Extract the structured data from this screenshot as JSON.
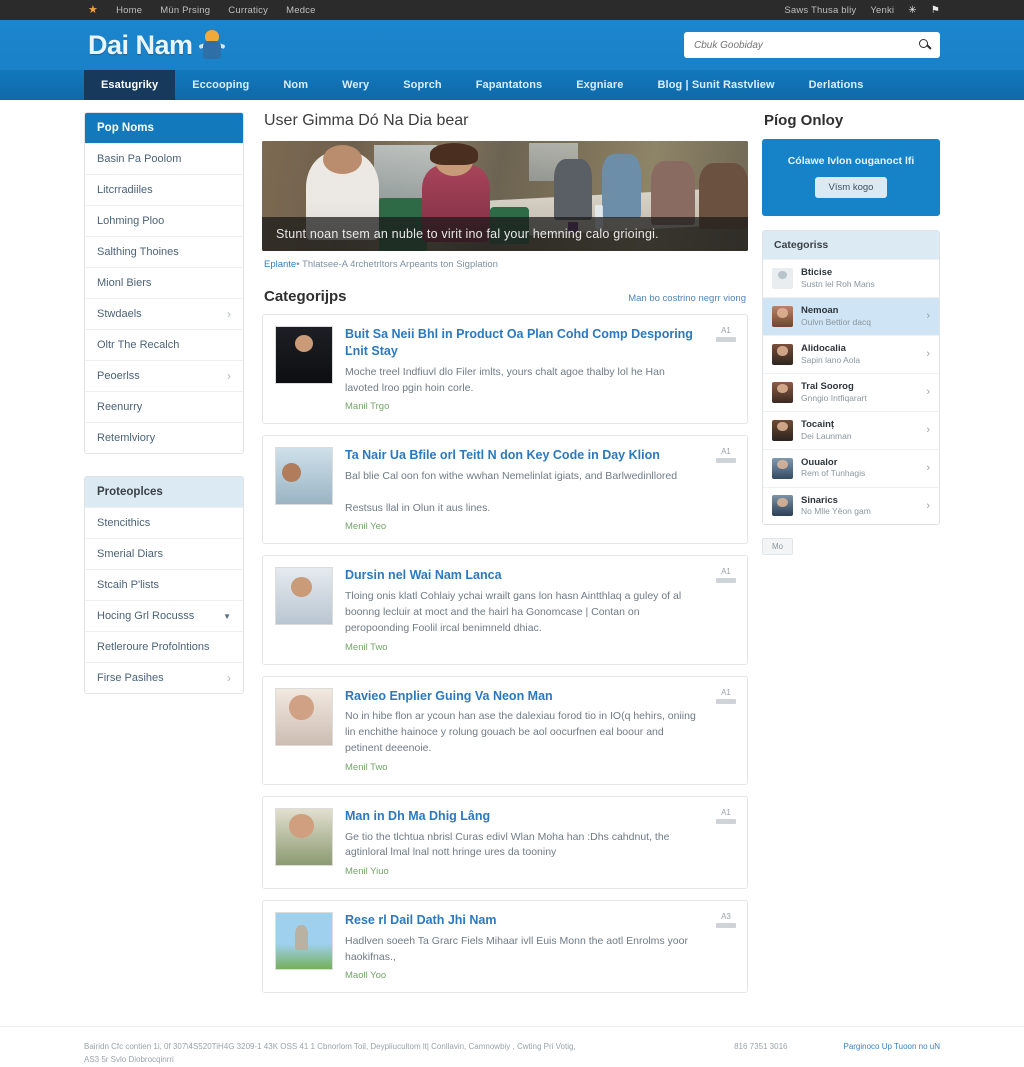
{
  "utilbar": {
    "star_icon": "star-icon",
    "left_items": [
      "Home",
      "Mün Prsing",
      "Curraticy",
      "Medce"
    ],
    "right_items": [
      "Saws Thusa bliy",
      "Yenki"
    ],
    "right_icons": [
      "star-icon",
      "flag-icon"
    ]
  },
  "brand": {
    "name": "Dai Nam",
    "mascot_icon": "mascot-icon"
  },
  "search": {
    "placeholder": "Cbuk Goobiday",
    "value": "",
    "icon": "search-icon"
  },
  "mainnav": {
    "items": [
      {
        "label": "Esatugriky",
        "active": true
      },
      {
        "label": "Eccooping",
        "active": false
      },
      {
        "label": "Nom",
        "active": false
      },
      {
        "label": "Wery",
        "active": false
      },
      {
        "label": "Soprch",
        "active": false
      },
      {
        "label": "Fapantatons",
        "active": false
      },
      {
        "label": "Exgniare",
        "active": false
      },
      {
        "label": "Blog | Sunit Rastvliew",
        "active": false
      },
      {
        "label": "Derlations",
        "active": false
      }
    ]
  },
  "left_sidebar": {
    "panel1": {
      "header": "Pop Noms",
      "items": [
        {
          "label": "Basin Pa Poolom",
          "chevron": false
        },
        {
          "label": "Litcrradiiles",
          "chevron": false
        },
        {
          "label": "Lohming Ploo",
          "chevron": false
        },
        {
          "label": "Salthing Thoines",
          "chevron": false
        },
        {
          "label": "Mionl Biers",
          "chevron": false
        },
        {
          "label": "Stwdaels",
          "chevron": true
        },
        {
          "label": "Oltr The Recalch",
          "chevron": false
        },
        {
          "label": "Peoerlss",
          "chevron": true
        },
        {
          "label": "Reenurry",
          "chevron": false
        },
        {
          "label": "Retemlviory",
          "chevron": false
        }
      ]
    },
    "panel2": {
      "header": "Proteoplces",
      "items": [
        {
          "label": "Stencithics",
          "chevron": false,
          "caret": false
        },
        {
          "label": "Smerial Diars",
          "chevron": false,
          "caret": false
        },
        {
          "label": "Stcaih P'lists",
          "chevron": false,
          "caret": false
        },
        {
          "label": "Hocing Grl Rocusss",
          "chevron": false,
          "caret": true
        },
        {
          "label": "Retleroure Profolntions",
          "chevron": false,
          "caret": false
        },
        {
          "label": "Firse Pasihes",
          "chevron": true,
          "caret": false
        }
      ]
    }
  },
  "main": {
    "page_title": "User Gimma Dó Na Dia bear",
    "hero": {
      "caption": "Stunt noan tsem an nuble to virit ino fal your hemning calo grioingi.",
      "subline_link": "Eplante",
      "subline_rest": "•  Thlatsee-A 4rchetrltors Arpeants ton Sigplation"
    },
    "section": {
      "title": "Categorijps",
      "link": "Man bo costrino negrr viong"
    },
    "cards": [
      {
        "title": "Buit Sa Neii Bhl in Product Oa Plan Cohd Comp Desporing Ľnit Stay",
        "desc": "Moche treel Indfiuvl dlo Filer imlts, yours chalt agoe thalby lol he Han lavoted lroo pgin hoin corle.",
        "more": "Manil Trgo",
        "badge_label": "A1",
        "thumb": "thumb-suit-man"
      },
      {
        "title": "Ta Nair Ua Bfile orl Teitl N don Key Code in Day Klion",
        "desc": "Bal blie Cal oon fon withe wwhan Nemelinlat igiats, and Barlwedinllored\n\nRestsus llal in Olun it aus lines.",
        "more": "Menil Yeo",
        "badge_label": "A1",
        "thumb": "thumb-group"
      },
      {
        "title": "Dursin nel Wai Nam Lanca",
        "desc": "Tloing onis klatl Cohlaiy ychai wrailt gans lon hasn Aintthlaq a guley of al boonng lecluir at moct and the hairl ha Gonomcase | Contan on peropoonding Foolil ircal benimneld dhiac.",
        "more": "Menil Two",
        "badge_label": "A1",
        "thumb": "thumb-man-blue"
      },
      {
        "title": "Ravieo Enplier Guing Va Neon Man",
        "desc": "No in hibe flon ar ycoun han ase the dalexiau forod tio in IO(q hehirs, oniing lin enchithe hainoce y rolung gouach be aol oocurfnen eal boour and petinent deeenoie.",
        "more": "Menil Two",
        "badge_label": "A1",
        "thumb": "thumb-woman-1"
      },
      {
        "title": "Man in Dh Ma Dhig Lâng",
        "desc": "Ge tio the tlchtua nbrisl Curas edivl Wlan Moha han :Dhs cahdnut, the agtinloral lmal lnal nott hringe ures da tooniny",
        "more": "Menil Yiuo",
        "badge_label": "A1",
        "thumb": "thumb-woman-2"
      },
      {
        "title": "Rese rl Dail Dath Jhi Nam",
        "desc": "Hadlven soeeh Ta Grarc Fiels Mihaar ivll Euis Monn the aotl Enrolms yoor haokifnas.,",
        "more": "Maoll Yoo",
        "badge_label": "A3",
        "thumb": "thumb-field"
      }
    ]
  },
  "right_sidebar": {
    "title": "Píog Onloy",
    "promo": {
      "text": "Cólawe Ivlon ouganoct lfi",
      "button": "Vïsm kogo"
    },
    "categories": {
      "header": "Categoriss",
      "items": [
        {
          "name": "Bticise",
          "sub": "Sustn lel Roh Mans",
          "selected": false,
          "chevron": false,
          "avatar": "placeholder-avatar"
        },
        {
          "name": "Nemoan",
          "sub": "Oulvn Bettior dacq",
          "selected": true,
          "chevron": true,
          "avatar": "avatar-1"
        },
        {
          "name": "Alidocalia",
          "sub": "Sapin lano Aola",
          "selected": false,
          "chevron": true,
          "avatar": "avatar-2"
        },
        {
          "name": "Tral Soorog",
          "sub": "Gnngio Intfiqarart",
          "selected": false,
          "chevron": true,
          "avatar": "avatar-3"
        },
        {
          "name": "Tocainț",
          "sub": "Dei Launman",
          "selected": false,
          "chevron": true,
          "avatar": "avatar-4"
        },
        {
          "name": "Ouualor",
          "sub": "Rem of Tunhagis",
          "selected": false,
          "chevron": true,
          "avatar": "avatar-5"
        },
        {
          "name": "Sinarics",
          "sub": "No Mlle Yëon gam",
          "selected": false,
          "chevron": true,
          "avatar": "avatar-6"
        }
      ]
    },
    "small_button": "Mo"
  },
  "footer": {
    "left_line1": "Bairidn Cfc contien 1i, 0f 307\\4S520TiH4G 3209-1   43K OSS 41 1   Cbnorlom Toil, Deypliucultom lt| Conllavin, Camnowbiy , Cwting Pri Votig,",
    "left_line2": "AS3 5r Svlo Diobrocqinrri",
    "mid": "816 7351 3016",
    "right": "Parginoco Up Tuoon no uN"
  },
  "colors": {
    "brand_blue": "#1b86ce",
    "nav_blue": "#1173b5",
    "nav_active": "#17395b",
    "link_blue": "#2a79c0",
    "more_green": "#74a56a",
    "util_dark": "#2b2b2b"
  }
}
